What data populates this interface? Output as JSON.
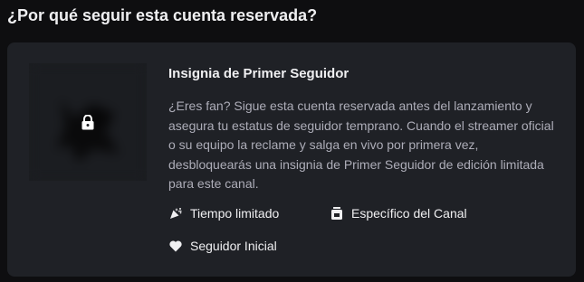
{
  "heading": "¿Por qué seguir esta cuenta reservada?",
  "card": {
    "image_locked": true,
    "lock_icon": "lock-icon",
    "title": "Insignia de Primer Seguidor",
    "description": "¿Eres fan? Sigue esta cuenta reservada antes del lanzamiento y asegura tu estatus de seguidor temprano. Cuando el streamer oficial o su equipo la reclame y salga en vivo por primera vez, desbloquearás una insignia de Primer Seguidor de edición limitada para este canal.",
    "features": [
      {
        "label": "Tiempo limitado",
        "icon": "party-popper-icon"
      },
      {
        "label": "Específico del Canal",
        "icon": "channel-icon"
      },
      {
        "label": "Seguidor Inicial",
        "icon": "heart-icon"
      }
    ]
  },
  "colors": {
    "background": "#0e0e10",
    "card": "#1f2126",
    "text": "#efeff1",
    "muted": "#adadb8"
  }
}
